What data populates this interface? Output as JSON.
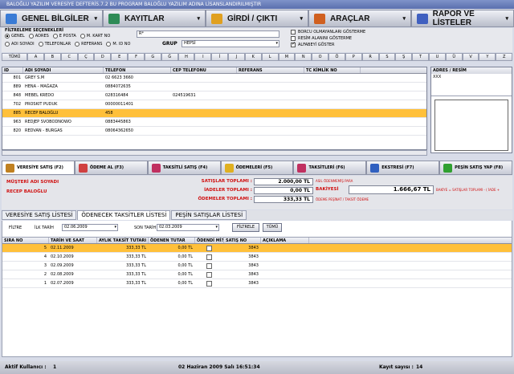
{
  "window": {
    "title": "BALOĞLU YAZILIM VERESİYE DEFTERİ5.7.2  BU PROGRAM BALOĞLU YAZILIM ADINA LİSANSLANDIRILMIŞTIR"
  },
  "menu": [
    {
      "label": "GENEL BİLGİLER",
      "icon": "person-card-icon",
      "color": "#3a7bd5"
    },
    {
      "label": "KAYITLAR",
      "icon": "people-icon",
      "color": "#2e8b57"
    },
    {
      "label": "GİRDİ / ÇIKTI",
      "icon": "handshake-icon",
      "color": "#e0a020"
    },
    {
      "label": "ARAÇLAR",
      "icon": "tools-icon",
      "color": "#d06020"
    },
    {
      "label": "RAPOR VE LİSTELER",
      "icon": "report-icon",
      "color": "#4060c0"
    }
  ],
  "filter": {
    "header": "FİLTRELEME SEÇENEKLERİ",
    "radios_row1": [
      {
        "label": "GENEL",
        "on": true
      },
      {
        "label": "ADRES",
        "on": false
      },
      {
        "label": "E POSTA",
        "on": false
      },
      {
        "label": "M. KART NO",
        "on": false
      }
    ],
    "radios_row2": [
      {
        "label": "ADI SOYADI",
        "on": false
      },
      {
        "label": "TELEFONLAR",
        "on": false
      },
      {
        "label": "REFERANS",
        "on": false
      },
      {
        "label": "M. ID NO",
        "on": false
      }
    ],
    "search_value": "R*",
    "group_label": "GRUP",
    "group_value": "HEPSİ",
    "checks": [
      {
        "label": "BORCU OLMAYANLARI GÖSTERME",
        "on": false
      },
      {
        "label": "RESİM ALANINI GÖSTERME",
        "on": false
      },
      {
        "label": "ALFABEYİ GÖSTER",
        "on": true
      }
    ]
  },
  "letters": [
    "TÜMÜ",
    "A",
    "B",
    "C",
    "Ç",
    "D",
    "E",
    "F",
    "G",
    "Ğ",
    "H",
    "I",
    "İ",
    "J",
    "K",
    "L",
    "M",
    "N",
    "O",
    "Ö",
    "P",
    "R",
    "S",
    "Ş",
    "T",
    "U",
    "Ü",
    "V",
    "Y",
    "Z"
  ],
  "customers": {
    "columns": [
      "ID",
      "ADI SOYADI",
      "TELEFON",
      "CEP TELEFONU",
      "REFERANS",
      "TC KİMLİK NO"
    ],
    "rows": [
      {
        "id": "801",
        "name": "GREY S.M",
        "phone": "02 6623 3660",
        "cell": "",
        "ref": "",
        "tc": "",
        "sel": false
      },
      {
        "id": "889",
        "name": "HENA - MAĞAZA",
        "phone": "0884072635",
        "cell": "",
        "ref": "",
        "tc": "",
        "sel": false
      },
      {
        "id": "848",
        "name": "MEBEL KREDO",
        "phone": "028316484",
        "cell": "024519631",
        "ref": "",
        "tc": "",
        "sel": false
      },
      {
        "id": "702",
        "name": "PROSKIT PUDUK",
        "phone": "00000011401",
        "cell": "",
        "ref": "",
        "tc": "",
        "sel": false
      },
      {
        "id": "885",
        "name": "RECEP BALOĞLU",
        "phone": "458",
        "cell": "",
        "ref": "",
        "tc": "",
        "sel": true
      },
      {
        "id": "963",
        "name": "REDJEP SVOBODNOWO",
        "phone": "0883445863",
        "cell": "",
        "ref": "",
        "tc": "",
        "sel": false
      },
      {
        "id": "820",
        "name": "REDVAN - BURGAS",
        "phone": "08064362650",
        "cell": "",
        "ref": "",
        "tc": "",
        "sel": false
      }
    ]
  },
  "address": {
    "title": "ADRES / RESİM",
    "value": "XXX"
  },
  "actions": [
    {
      "label": "VERESİYE SATIŞ  (F2)",
      "icon": "ledger-icon",
      "color": "#c08020",
      "active": true
    },
    {
      "label": "ÖDEME AL  (F3)",
      "icon": "payment-icon",
      "color": "#d04040",
      "active": false
    },
    {
      "label": "TAKSİTLİ SATIŞ  (F4)",
      "icon": "installment-icon",
      "color": "#c03060",
      "active": false
    },
    {
      "label": "ÖDEMELERİ  (F5)",
      "icon": "folder-icon",
      "color": "#e0b020",
      "active": false
    },
    {
      "label": "TAKSİTLERİ  (F6)",
      "icon": "calendar-icon",
      "color": "#c03060",
      "active": false
    },
    {
      "label": "EKSTRESİ  (F7)",
      "icon": "statement-icon",
      "color": "#3060c0",
      "active": false
    },
    {
      "label": "PEŞİN SATIŞ YAP  (F8)",
      "icon": "cash-sale-icon",
      "color": "#30a030",
      "active": false
    }
  ],
  "customer_info": {
    "name_label": "MÜŞTERİ ADI SOYADI",
    "name": "RECEP BALOĞLU",
    "total_sales_label": "SATIŞLAR TOPLAMI :",
    "total_sales": "2.000,00 TL",
    "returns_label": "İADELER TOPLAMI :",
    "returns": "0,00 TL",
    "payments_label": "ÖDEMELER TOPLAMI :",
    "payments": "333,33 TL",
    "balance_label": "BAKİYESİ",
    "balance": "1.666,67 TL",
    "note_top": "ASIL ÖDENMEMİŞ PARA",
    "note_bottom": "ÖDEME PEŞİNAT / TAKSİT ÖDEME",
    "formula": "BAKİYE = SATIŞLAR TOPLAMI - ( İADE +"
  },
  "sub_tabs": [
    {
      "label": "VERESİYE SATIŞ LİSTESİ",
      "active": false
    },
    {
      "label": "ÖDENECEK TAKSİTLER LİSTESİ",
      "active": true
    },
    {
      "label": "PEŞİN SATIŞLAR LİSTESİ",
      "active": false
    }
  ],
  "date_filter": {
    "label": "FİLTRE",
    "start_label": "İLK TARİH",
    "start": "02.06.2009",
    "end_label": "SON TARİH",
    "end": "02.03.2009",
    "filter_btn": "FİLTRELE",
    "all_btn": "TÜMÜ"
  },
  "installments": {
    "columns": [
      "SIRA NO",
      "TARİH VE SAAT",
      "AYLIK TAKSİT TUTARI",
      "ÖDENEN TUTAR",
      "ÖDENDİ Mİ?",
      "SATIŞ NO",
      "AÇIKLAMA"
    ],
    "rows": [
      {
        "no": "5",
        "date": "02.11.2009",
        "amount": "333,33 TL",
        "paid": "0,00 TL",
        "sale": "3843",
        "sel": true
      },
      {
        "no": "4",
        "date": "02.10.2009",
        "amount": "333,33 TL",
        "paid": "0,00 TL",
        "sale": "3843",
        "sel": false
      },
      {
        "no": "3",
        "date": "02.09.2009",
        "amount": "333,33 TL",
        "paid": "0,00 TL",
        "sale": "3843",
        "sel": false
      },
      {
        "no": "2",
        "date": "02.08.2009",
        "amount": "333,33 TL",
        "paid": "0,00 TL",
        "sale": "3843",
        "sel": false
      },
      {
        "no": "1",
        "date": "02.07.2009",
        "amount": "333,33 TL",
        "paid": "0,00 TL",
        "sale": "3843",
        "sel": false
      }
    ]
  },
  "status": {
    "user_label": "Aktif Kullanıcı :",
    "user": "1",
    "datetime": "02 Haziran 2009 Salı 16:51:34",
    "count_label": "Kayıt sayısı :",
    "count": "14"
  }
}
